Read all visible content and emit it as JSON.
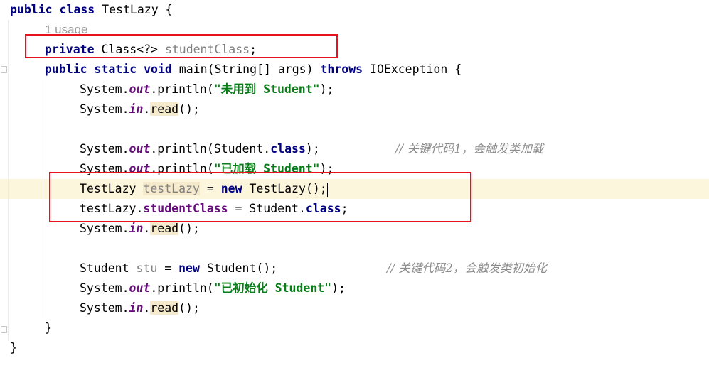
{
  "colors": {
    "keyword": "#000080",
    "string": "#067d17",
    "comment": "#8c8c8c",
    "field": "#660e7a",
    "highlight_box": "#e8121e",
    "current_line": "#fcf6dc"
  },
  "code": {
    "line1": {
      "public": "public",
      "class": "class",
      "name": " TestLazy {",
      "lead": ""
    },
    "line2": {
      "usage": "1 usage"
    },
    "line3": {
      "private": "private",
      "type": " Class<?> ",
      "field": "studentClass",
      "semi": ";"
    },
    "line4": {
      "public": "public",
      "static": "static",
      "void": "void",
      "sig": " main(String[] args) ",
      "throws": "throws",
      "exc": " IOException {"
    },
    "line5": {
      "sys": "System.",
      "out": "out",
      "call": ".println(",
      "str": "\"未用到 Student\"",
      "end": ");"
    },
    "line6": {
      "sys": "System.",
      "in": "in",
      "dot": ".",
      "read": "read",
      "end": "();"
    },
    "line8": {
      "sys": "System.",
      "out": "out",
      "call": ".println(Student.",
      "class": "class",
      "end": ");",
      "comment": "// 关键代码1，会触发类加载"
    },
    "line9": {
      "sys": "System.",
      "out": "out",
      "call": ".println(",
      "str": "\"已加载 Student\"",
      "end": ");"
    },
    "line10": {
      "type": "TestLazy ",
      "var": "testLazy",
      "eq": " = ",
      "new": "new",
      "ctor": " TestLazy();"
    },
    "line11": {
      "var": "testLazy.",
      "field": "studentClass",
      "eq": " = Student.",
      "class": "class",
      "end": ";"
    },
    "line12": {
      "sys": "System.",
      "in": "in",
      "dot": ".",
      "read": "read",
      "end": "();"
    },
    "line14": {
      "type": "Student ",
      "var": "stu",
      "eq": " = ",
      "new": "new",
      "ctor": " Student();",
      "comment": "// 关键代码2，会触发类初始化"
    },
    "line15": {
      "sys": "System.",
      "out": "out",
      "call": ".println(",
      "str": "\"已初始化 Student\"",
      "end": ");"
    },
    "line16": {
      "sys": "System.",
      "in": "in",
      "dot": ".",
      "read": "read",
      "end": "();"
    },
    "line17": {
      "brace": "}"
    },
    "line18": {
      "brace": "}"
    }
  }
}
